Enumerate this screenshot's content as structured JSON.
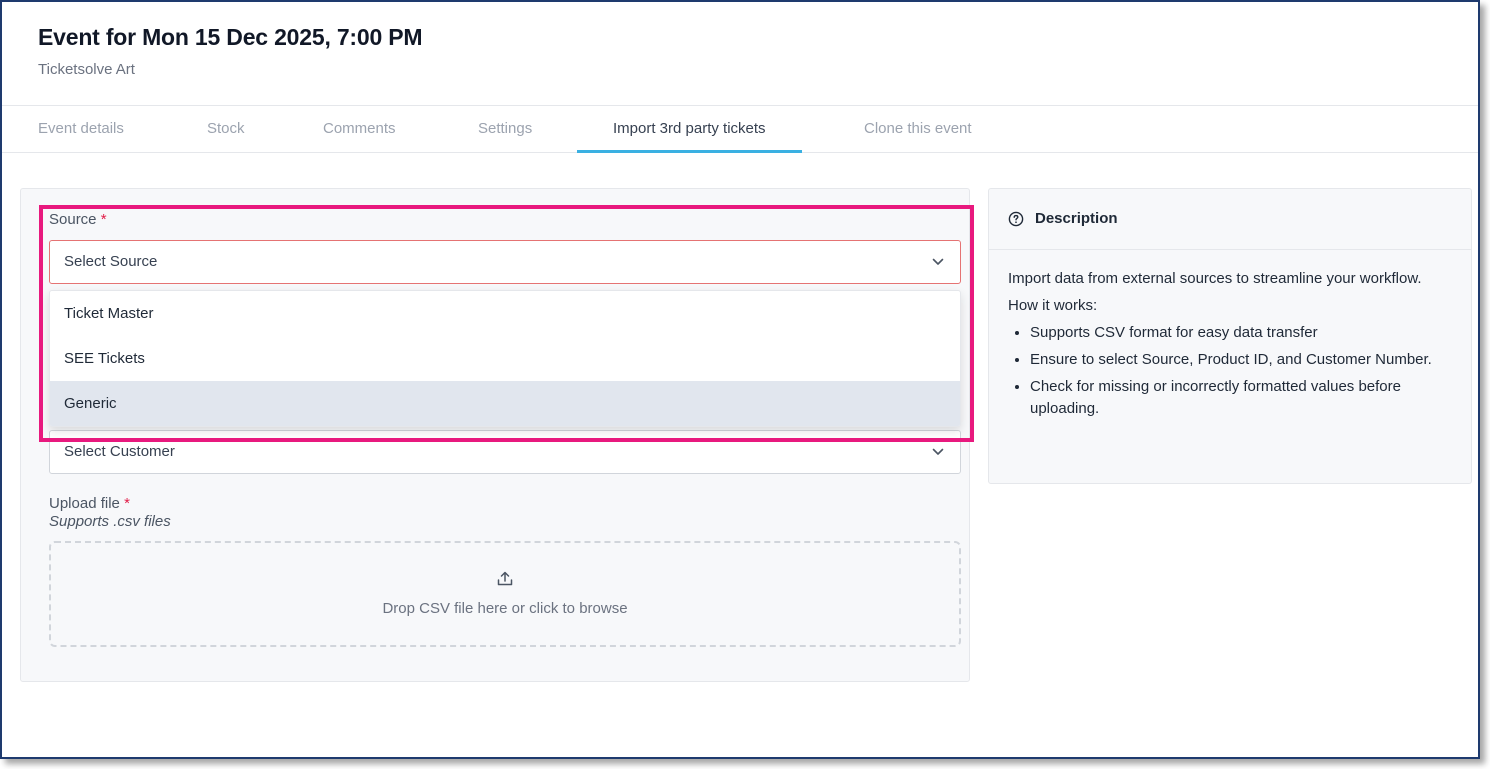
{
  "header": {
    "title": "Event for Mon 15 Dec 2025, 7:00 PM",
    "subtitle": "Ticketsolve Art"
  },
  "tabs": [
    {
      "label": "Event details"
    },
    {
      "label": "Stock"
    },
    {
      "label": "Comments"
    },
    {
      "label": "Settings"
    },
    {
      "label": "Import 3rd party tickets",
      "active": true
    },
    {
      "label": "Clone this event"
    }
  ],
  "form": {
    "source": {
      "label": "Source",
      "required_mark": "*",
      "value": "Select Source",
      "options": [
        "Ticket Master",
        "SEE Tickets",
        "Generic"
      ],
      "highlighted_option": "Generic"
    },
    "customer": {
      "value": "Select Customer"
    },
    "upload": {
      "label": "Upload file",
      "required_mark": "*",
      "hint": "Supports .csv files",
      "drop_text": "Drop CSV file here or click to browse"
    }
  },
  "description": {
    "title": "Description",
    "intro": "Import data from external sources to streamline your workflow.",
    "how_label": "How it works:",
    "items": [
      "Supports CSV format for easy data transfer",
      "Ensure to select Source, Product ID, and Customer Number.",
      "Check for missing or incorrectly formatted values before uploading."
    ]
  },
  "colors": {
    "accent_tab": "#3ab0e2",
    "highlight_box": "#e8197e",
    "required": "#e11d48",
    "frame_border": "#1e3a6e"
  }
}
